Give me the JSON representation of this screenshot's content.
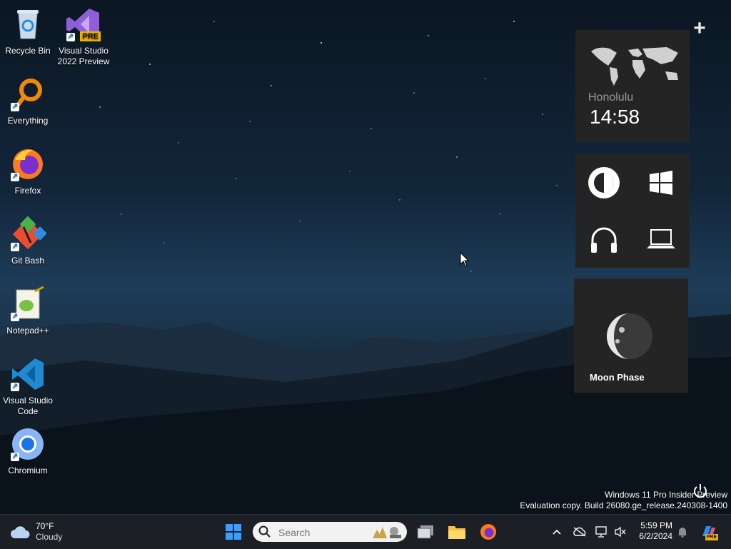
{
  "desktop": {
    "icons": [
      {
        "label": "Recycle Bin"
      },
      {
        "label": "Visual Studio 2022 Preview",
        "badge": "PRE"
      },
      {
        "label": "Everything"
      },
      {
        "label": "Firefox"
      },
      {
        "label": "Git Bash"
      },
      {
        "label": "Notepad++"
      },
      {
        "label": "Visual Studio Code"
      },
      {
        "label": "Chromium"
      }
    ]
  },
  "widgets": {
    "clock": {
      "city": "Honolulu",
      "time": "14:58"
    },
    "launcher": {
      "items": [
        "contrast-icon",
        "windows-icon",
        "headphones-icon",
        "laptop-icon"
      ]
    },
    "moon": {
      "label": "Moon Phase"
    },
    "add_label": "+"
  },
  "watermark": {
    "line1": "Windows 11 Pro Insider Preview",
    "line2": "Evaluation copy. Build 26080.ge_release.240308-1400"
  },
  "taskbar": {
    "weather": {
      "temp": "70°F",
      "condition": "Cloudy"
    },
    "search_placeholder": "Search",
    "clock": {
      "time": "5:59 PM",
      "date": "6/2/2024"
    },
    "copilot_badge": "PRE"
  },
  "colors": {
    "taskbar_bg": "#1c2026",
    "widget_bg": "#242424",
    "accent_blue": "#0078d4"
  }
}
